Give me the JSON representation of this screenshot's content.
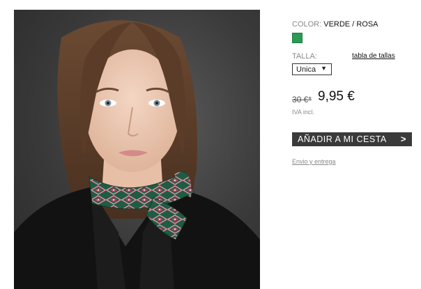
{
  "product": {
    "photo_alt": "",
    "color_label": "COLOR:",
    "color_value": "VERDE / ROSA",
    "swatch_color": "#2a9a55",
    "size_label": "TALLA:",
    "size_chart_link": "tabla de tallas",
    "size_selected": "Unica",
    "size_arrow": "▼",
    "old_price": "30 €*",
    "new_price": "9,95 €",
    "tax_note": "IVA incl.",
    "add_to_cart_label": "AÑADIR A MI CESTA",
    "add_to_cart_chevron": ">",
    "shipping_link": "Envio y entrega"
  }
}
